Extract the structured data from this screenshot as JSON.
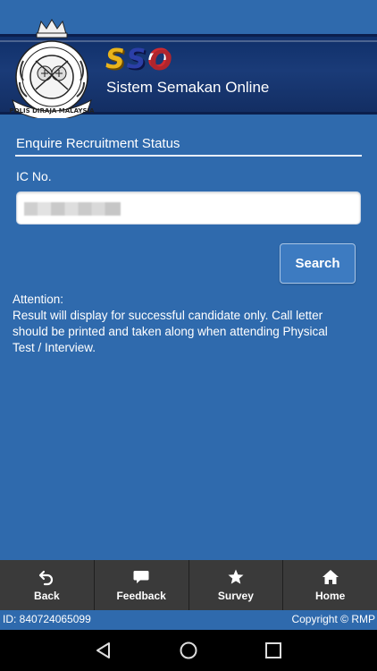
{
  "header": {
    "logo_text": "SSO",
    "logo_letters": [
      "S",
      "S",
      "O"
    ],
    "subtitle": "Sistem Semakan Online",
    "crest_text": "POLIS DIRAJA MALAYSIA"
  },
  "form": {
    "section_title": "Enquire Recruitment Status",
    "ic_label": "IC No.",
    "search_label": "Search"
  },
  "attention": {
    "heading": "Attention:",
    "body": "Result will display for successful candidate only. Call letter should be printed and taken along when attending Physical Test / Interview."
  },
  "tabbar": {
    "items": [
      {
        "label": "Back",
        "icon": "undo-arrow-icon"
      },
      {
        "label": "Feedback",
        "icon": "chat-bubble-icon"
      },
      {
        "label": "Survey",
        "icon": "star-icon"
      },
      {
        "label": "Home",
        "icon": "home-icon"
      }
    ]
  },
  "footer": {
    "id_text": "ID: 840724065099",
    "copyright": "Copyright © RMP"
  },
  "colors": {
    "background": "#2f6aad",
    "header": "#1a3b78",
    "tabbar": "#3a3a3a",
    "button": "#3d7bc1"
  }
}
